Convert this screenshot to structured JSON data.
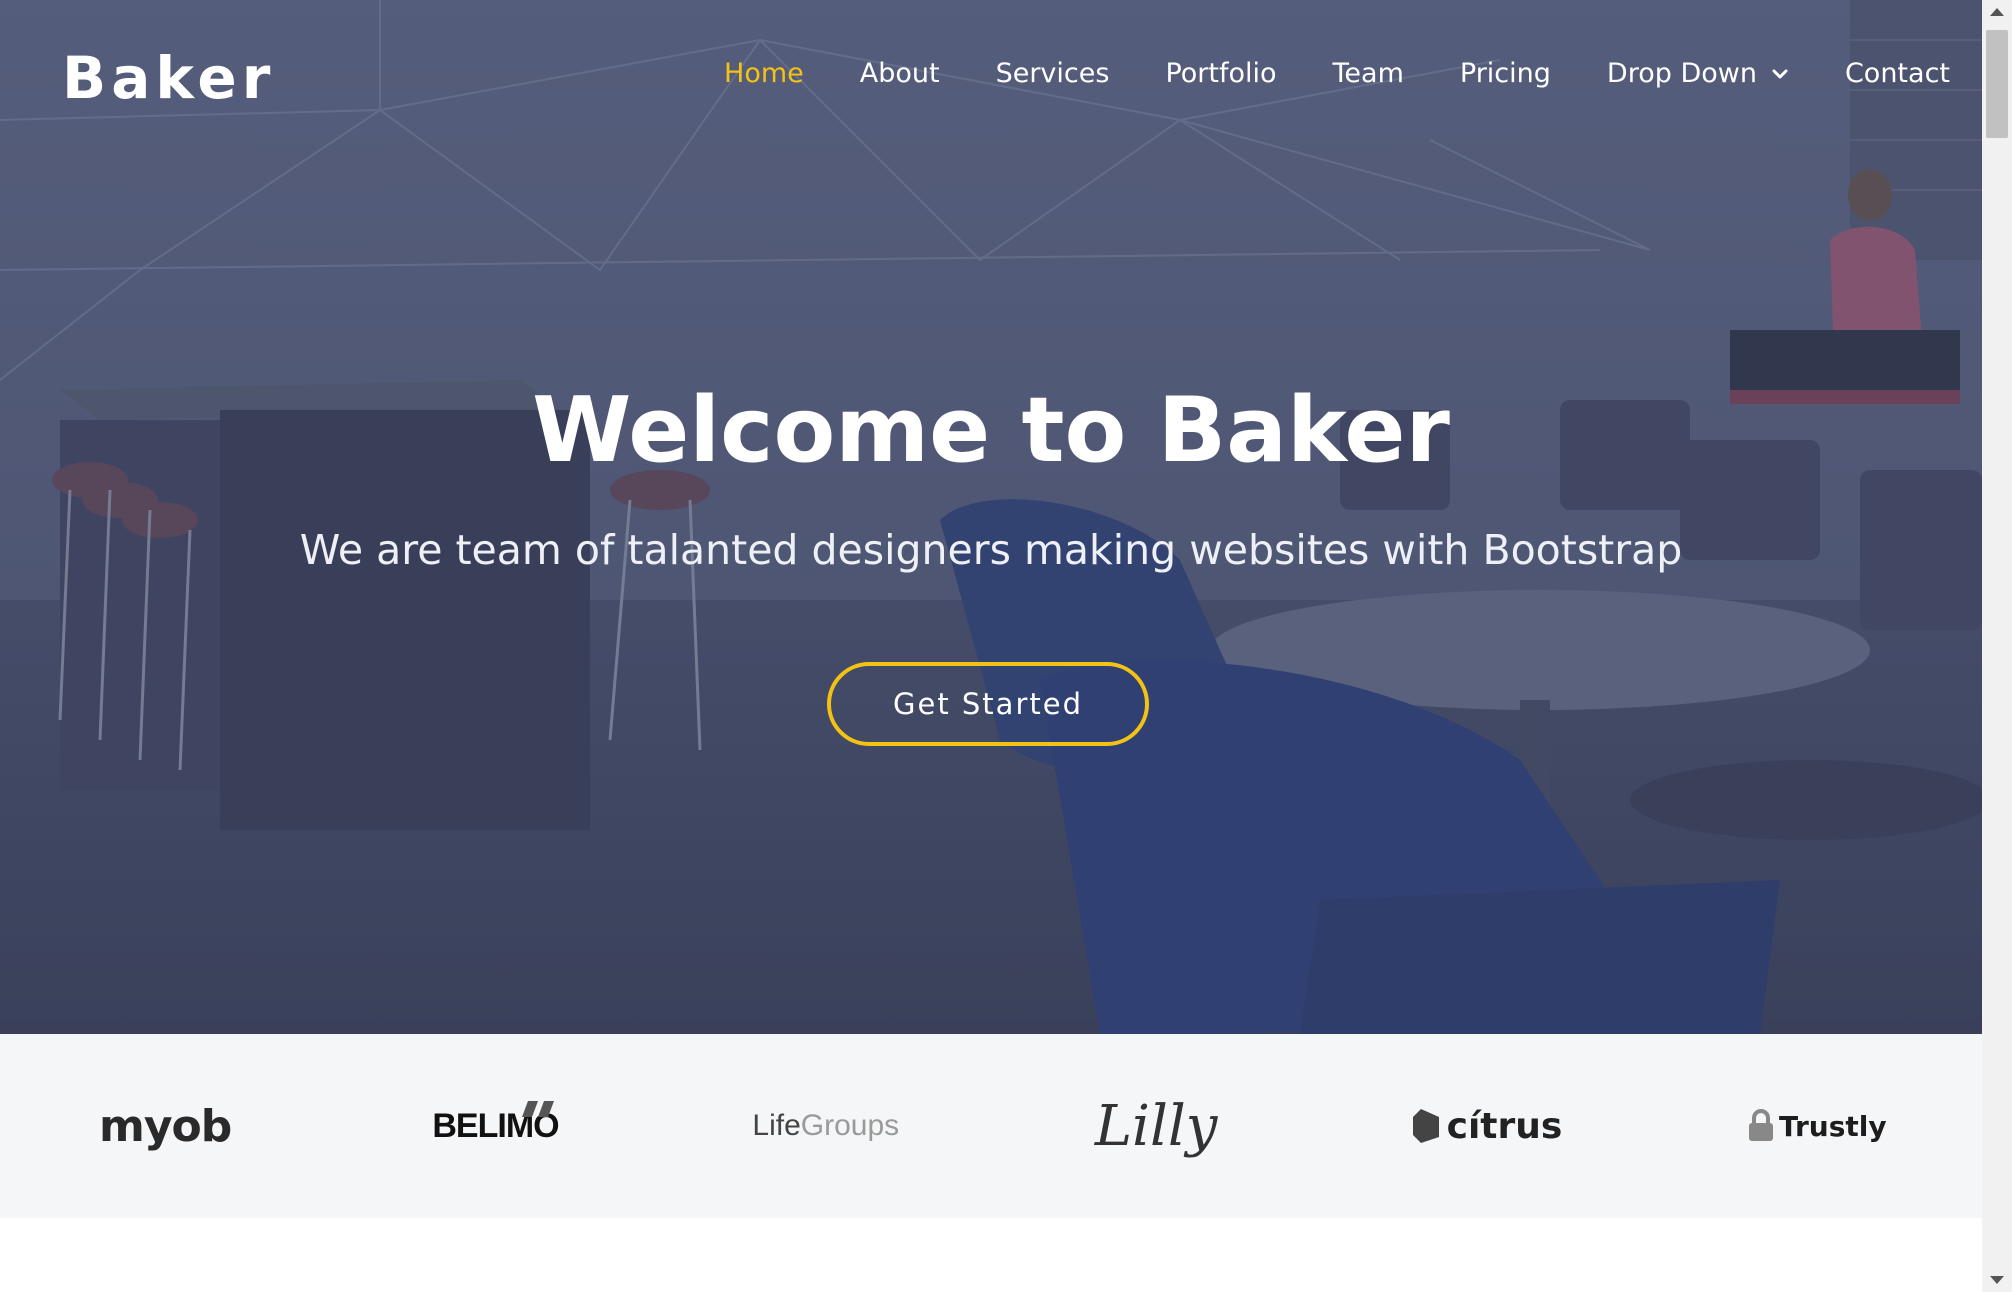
{
  "header": {
    "logo": "Baker",
    "nav": [
      {
        "label": "Home",
        "active": true
      },
      {
        "label": "About"
      },
      {
        "label": "Services"
      },
      {
        "label": "Portfolio"
      },
      {
        "label": "Team"
      },
      {
        "label": "Pricing"
      },
      {
        "label": "Drop Down",
        "has_dropdown": true
      },
      {
        "label": "Contact"
      }
    ]
  },
  "hero": {
    "title": "Welcome to Baker",
    "subtitle": "We are team of talanted designers making websites with Bootstrap",
    "cta": "Get Started"
  },
  "clients": [
    {
      "name": "myob"
    },
    {
      "name": "BELIMO"
    },
    {
      "name": "LifeGroups",
      "part1": "Life",
      "part2": "Groups"
    },
    {
      "name": "Lilly"
    },
    {
      "name": "cítrus"
    },
    {
      "name": "Trustly"
    }
  ],
  "colors": {
    "accent": "#f2c214",
    "hero_overlay": "#363e5c",
    "clients_bg": "#f5f6f8"
  }
}
